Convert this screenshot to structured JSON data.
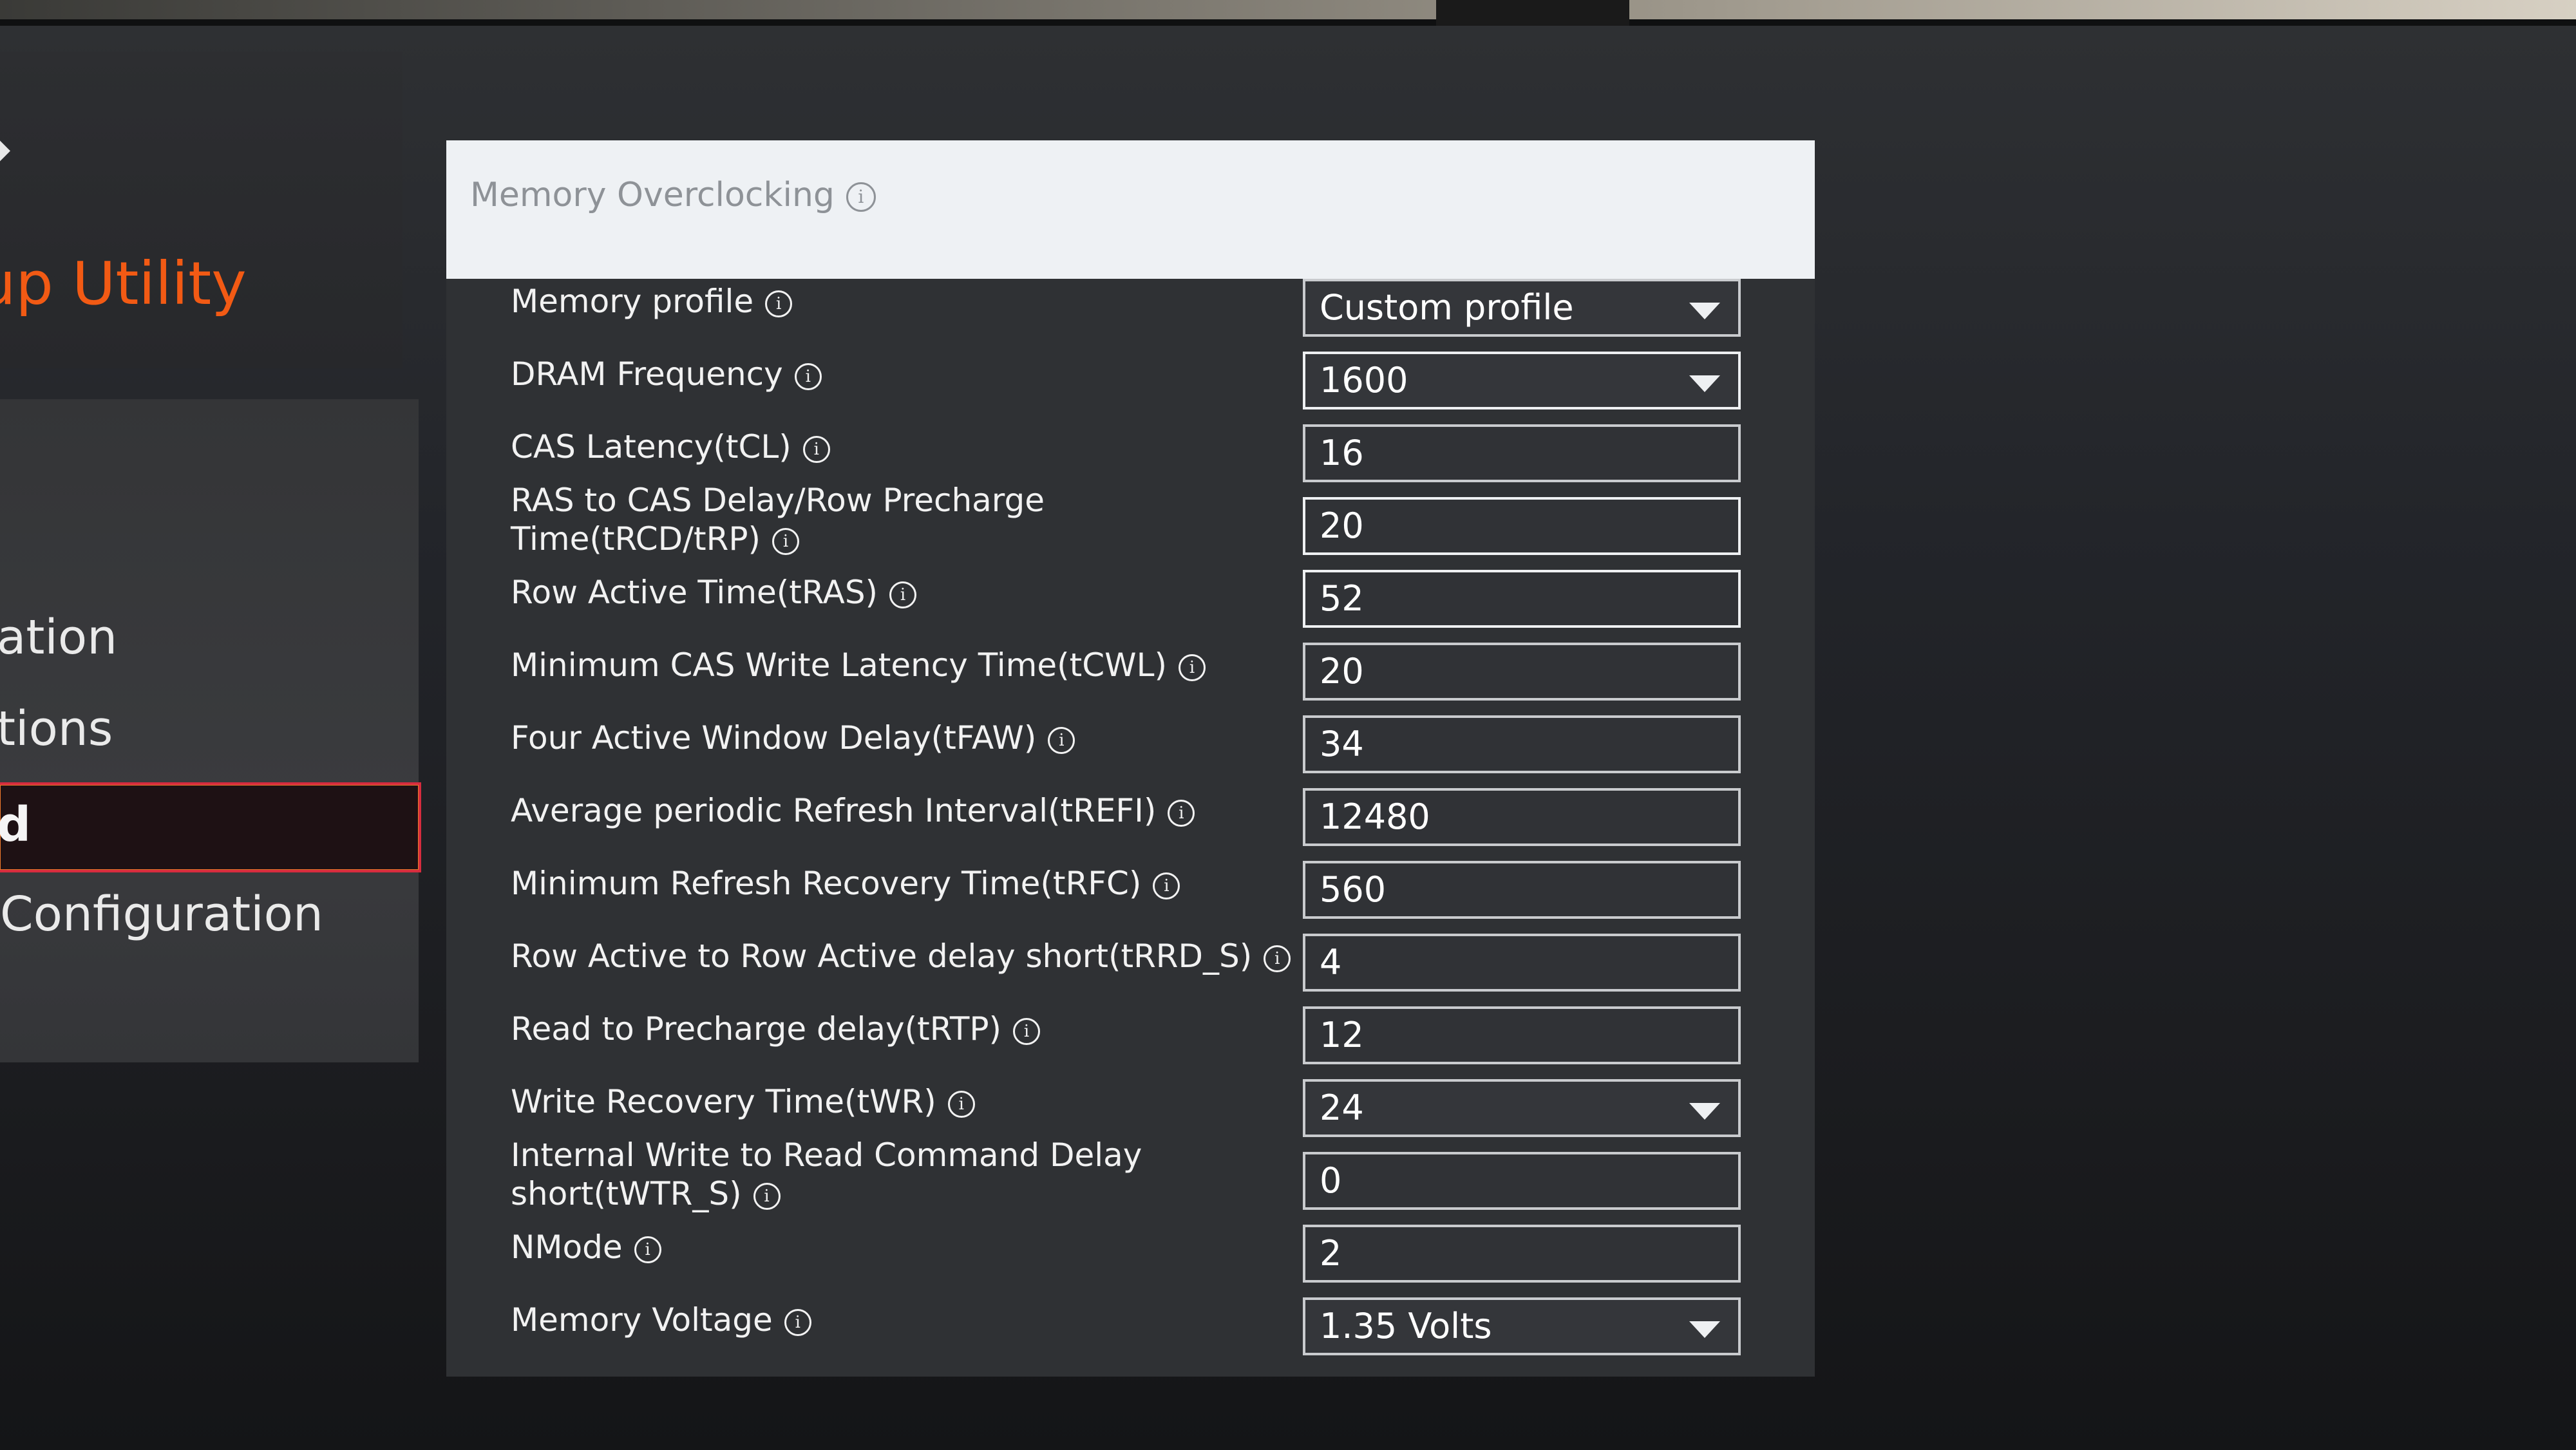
{
  "sidebar": {
    "brand_title": "tup Utility",
    "logo_icon": "logo-icon",
    "items": [
      {
        "label": "ation",
        "selected": false
      },
      {
        "label": "tions",
        "selected": false
      },
      {
        "label": "d",
        "selected": true
      },
      {
        "label": "Configuration",
        "selected": false
      }
    ],
    "selected_border_color": "#d62c3e"
  },
  "panel": {
    "title": "Memory Overclocking",
    "title_icon": "info-icon"
  },
  "settings": [
    {
      "label": "Memory profile",
      "value": "Custom profile",
      "type": "dropdown"
    },
    {
      "label": "DRAM Frequency",
      "value": "1600",
      "type": "dropdown"
    },
    {
      "label": "CAS Latency(tCL)",
      "value": "16",
      "type": "input"
    },
    {
      "label": "RAS to CAS Delay/Row Precharge Time(tRCD/tRP)",
      "value": "20",
      "type": "input"
    },
    {
      "label": "Row Active Time(tRAS)",
      "value": "52",
      "type": "input"
    },
    {
      "label": "Minimum CAS Write Latency Time(tCWL)",
      "value": "20",
      "type": "input"
    },
    {
      "label": "Four Active Window Delay(tFAW)",
      "value": "34",
      "type": "input"
    },
    {
      "label": "Average periodic Refresh Interval(tREFI)",
      "value": "12480",
      "type": "input"
    },
    {
      "label": "Minimum Refresh Recovery Time(tRFC)",
      "value": "560",
      "type": "input"
    },
    {
      "label": "Row Active to Row Active delay short(tRRD_S)",
      "value": "4",
      "type": "input"
    },
    {
      "label": "Read to Precharge delay(tRTP)",
      "value": "12",
      "type": "input"
    },
    {
      "label": "Write Recovery Time(tWR)",
      "value": "24",
      "type": "dropdown"
    },
    {
      "label": "Internal Write to Read Command Delay short(tWTR_S)",
      "value": "0",
      "type": "input"
    },
    {
      "label": "NMode",
      "value": "2",
      "type": "input"
    },
    {
      "label": "Memory Voltage",
      "value": "1.35 Volts",
      "type": "dropdown"
    }
  ],
  "colors": {
    "brand_orange": "#f25a14",
    "panel_bg": "#2f3134",
    "header_bg": "#eef1f4",
    "field_border": "#c9cbce"
  }
}
